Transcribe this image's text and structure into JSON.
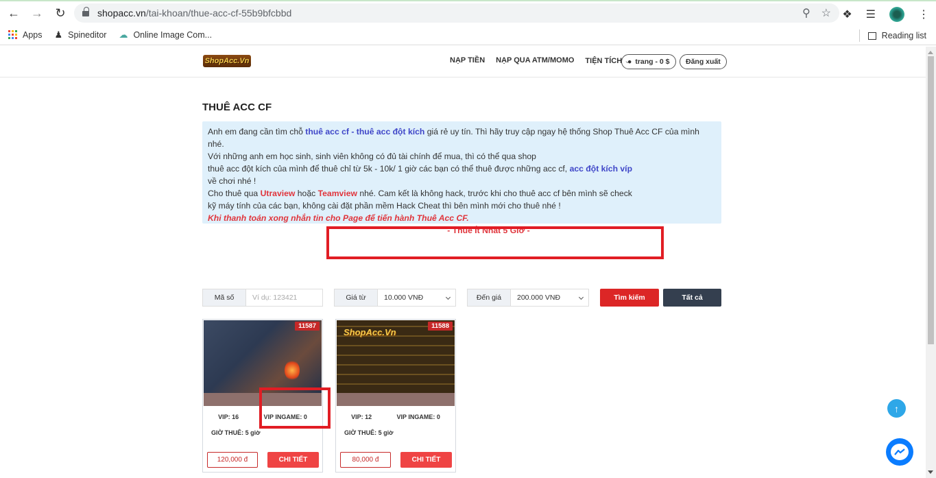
{
  "browser": {
    "url_domain": "shopacc.vn",
    "url_path": "/tai-khoan/thue-acc-cf-55b9bfcbbd",
    "bookmarks": [
      {
        "label": "Apps",
        "icon": "apps-grid-icon"
      },
      {
        "label": "Spineditor",
        "icon": "spy-icon"
      },
      {
        "label": "Online Image Com...",
        "icon": "cloud-icon"
      }
    ],
    "reading_list": "Reading list"
  },
  "header": {
    "logo_text": "ShopAcc.Vn",
    "menu": [
      "NẠP TIỀN",
      "NẠP QUA ATM/MOMO",
      "TIỆN TÍCH"
    ],
    "user": "trang - 0 $",
    "logout": "Đăng xuất"
  },
  "page": {
    "title": "THUÊ ACC CF",
    "info": {
      "l1_a": "Anh em đang cần tìm chỗ ",
      "l1_link": "thuê acc cf - thuê acc đột kích",
      "l1_b": " giá rẻ uy tín. Thì hãy truy cập ngay hệ thống Shop Thuê Acc CF của mình nhé.",
      "l2": "Với những anh em học sinh, sinh viên không có đủ tài chính để mua, thì có thể qua shop",
      "l3_a": "thuê acc đột kích của mình để thuê chỉ từ 5k - 10k/ 1 giờ các bạn có thể thuê được những acc cf, ",
      "l3_link": "acc đột kích víp",
      "l4": "về chơi nhé !",
      "l5_a": "Cho thuê qua ",
      "l5_u": "Utraview",
      "l5_b": " hoặc ",
      "l5_t": "Teamview",
      "l5_c": " nhé. Cam kết là không hack, trước khi cho thuê acc cf bên mình sẽ check",
      "l6": "kỹ máy tính của các bạn, không cài đặt phần mềm Hack Cheat thì bên mình mới cho thuê nhé !",
      "l7": "Khi thanh toán xong nhắn tin cho Page để tiến hành Thuê Acc CF.",
      "l8": "- Thuê Ít Nhất 5 Giờ -"
    }
  },
  "filters": {
    "code_label": "Mã số",
    "code_placeholder": "Ví dụ: 123421",
    "from_label": "Giá từ",
    "from_value": "10.000 VNĐ",
    "to_label": "Đến giá",
    "to_value": "200.000 VNĐ",
    "search_button": "Tìm kiếm",
    "all_button": "Tất cả"
  },
  "cards": [
    {
      "id": "11587",
      "vip": "VIP: 16",
      "vip_ingame": "VIP INGAME: 0",
      "hours": "GIỜ THUÊ: 5 giờ",
      "price": "120,000 đ",
      "detail": "CHI TIẾT"
    },
    {
      "id": "11588",
      "vip": "VIP: 12",
      "vip_ingame": "VIP INGAME: 0",
      "hours": "GIỜ THUÊ: 5 giờ",
      "price": "80,000 đ",
      "detail": "CHI TIẾT",
      "image_text": "ShopAcc.Vn"
    }
  ],
  "colors": {
    "accent_red": "#dc2626",
    "dark_button": "#343f4f",
    "info_bg": "#dff0fb",
    "link_blue": "#3f46c8"
  }
}
